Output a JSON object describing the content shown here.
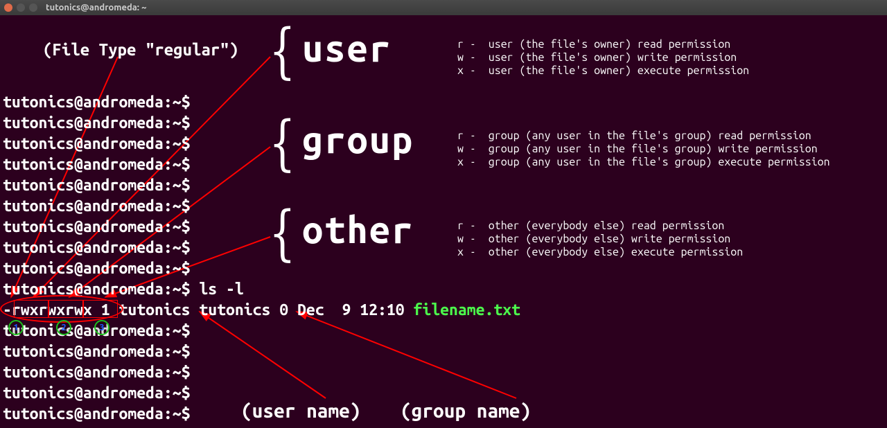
{
  "window": {
    "title": "tutonics@andromeda: ~"
  },
  "prompt": "tutonics@andromeda:~$ ",
  "command": "ls -l",
  "ls_line": {
    "dash": "-",
    "perm_user": "rwx",
    "perm_group": "rwx",
    "perm_other": "rwx",
    "rest": " 1 tutonics tutonics 0 Dec  9 12:10 ",
    "filename": "filename.txt"
  },
  "file_type_label": "(File Type \"regular\")",
  "sections": {
    "user": {
      "label": "user",
      "r": "r -  user (the file's owner) read permission",
      "w": "w -  user (the file's owner) write permission",
      "x": "x -  user (the file's owner) execute permission"
    },
    "group": {
      "label": "group",
      "r": "r -  group (any user in the file's group) read permission",
      "w": "w -  group (any user in the file's group) write permission",
      "x": "x -  group (any user in the file's group) execute permission"
    },
    "other": {
      "label": "other",
      "r": "r -  other (everybody else) read permission",
      "w": "w -  other (everybody else) write permission",
      "x": "x -  other (everybody else) execute permission"
    }
  },
  "bottom_labels": {
    "user_name": "(user name)",
    "group_name": "(group name)"
  },
  "circle_numbers": {
    "one": "1",
    "two": "2",
    "three": "3"
  }
}
